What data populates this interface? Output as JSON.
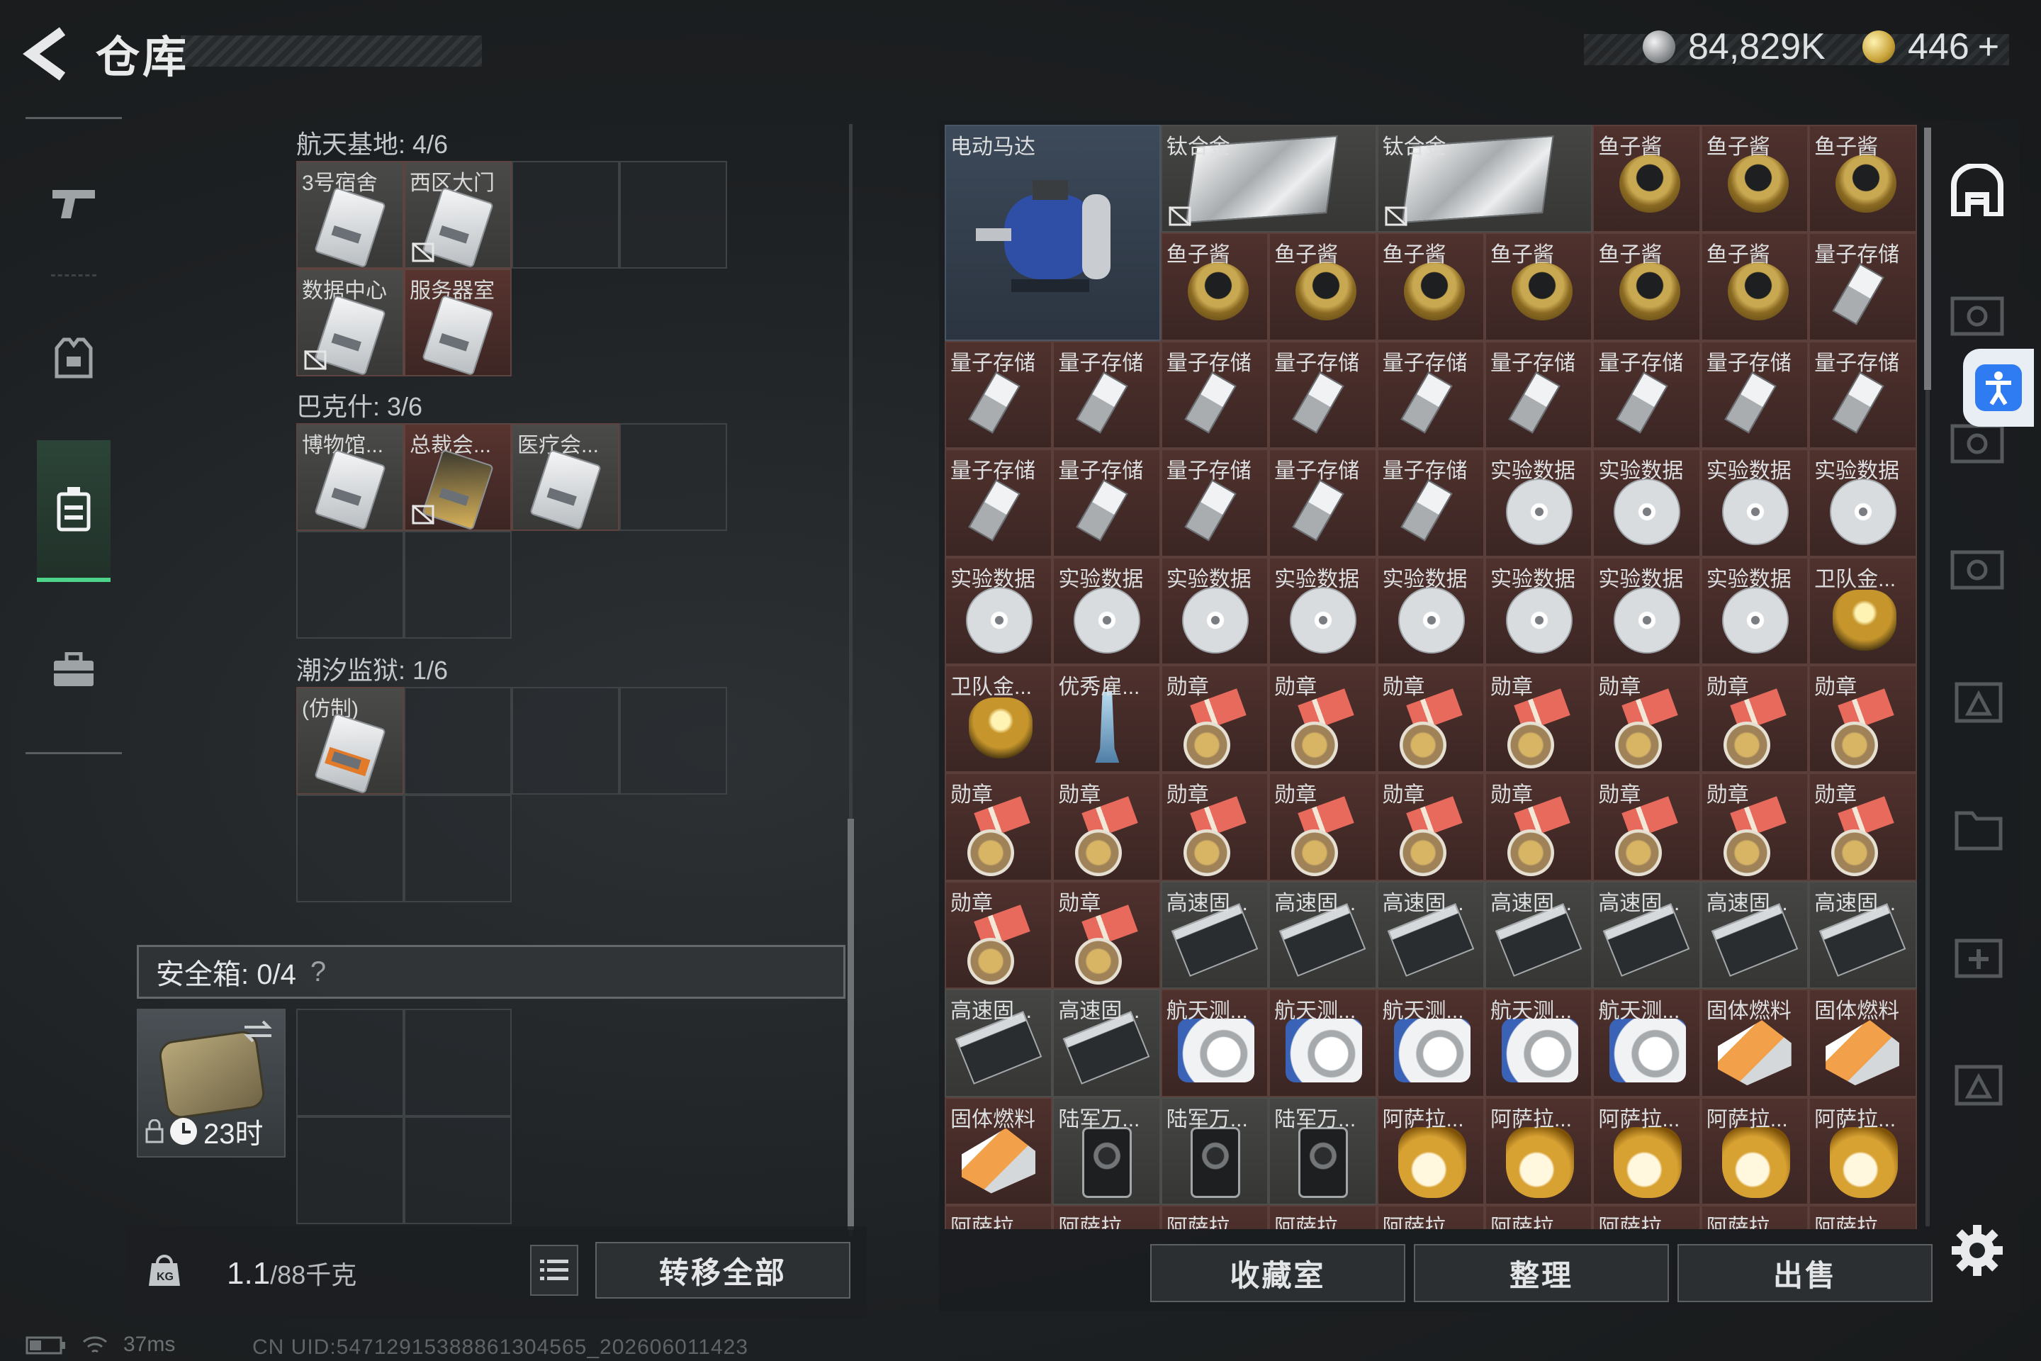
{
  "header": {
    "title": "仓库",
    "currency_silver": "84,829K",
    "currency_gold": "446",
    "currency_plus": "+"
  },
  "colors": {
    "accent_green": "#4ed38a",
    "item_red_bg": "#4f312d",
    "button_bg": "#2b2f32"
  },
  "nav": {
    "items": [
      {
        "name": "weapon",
        "icon": "gun-icon"
      },
      {
        "name": "gear",
        "icon": "vest-icon"
      },
      {
        "name": "storage",
        "icon": "bag-icon",
        "active": true
      },
      {
        "name": "kit",
        "icon": "briefcase-icon"
      }
    ]
  },
  "left": {
    "sections": [
      {
        "title": "航天基地: 4/6",
        "cells": [
          "3号宿舍",
          "西区大门",
          "",
          "",
          "数据中心",
          "服务器室",
          "",
          ""
        ]
      },
      {
        "title": "巴克什: 3/6",
        "cells": [
          "博物馆...",
          "总裁会...",
          "医疗会...",
          "",
          "",
          "",
          "",
          ""
        ]
      },
      {
        "title": "潮汐监狱: 1/6",
        "cells": [
          "(仿制)",
          "",
          "",
          "",
          "",
          "",
          "",
          ""
        ]
      }
    ],
    "safe_box": {
      "label": "安全箱: 0/4",
      "help": "?",
      "timer": "23时"
    },
    "weight_value": "1.1",
    "weight_max": "/88千克",
    "transfer_all": "转移全部"
  },
  "right": {
    "items": {
      "motor": "电动马达",
      "titanium_1": "钛合金",
      "titanium_2": "钛合金",
      "caviar": "鱼子酱",
      "quantum": "量子存储",
      "exp_data": "实验数据",
      "guard_ring": "卫队金...",
      "excellent": "优秀雇...",
      "medal": "勋章",
      "ssd": "高速固...",
      "aero_gyro": "航天测...",
      "solid_fuel": "固体燃料",
      "army_radio": "陆军万...",
      "asala_cup": "阿萨拉..."
    },
    "buttons": {
      "collection": "收藏室",
      "organize": "整理",
      "sell": "出售"
    }
  },
  "status": {
    "ping": "37ms",
    "uid": "CN UID:547129153888613045​65_202606011423"
  }
}
